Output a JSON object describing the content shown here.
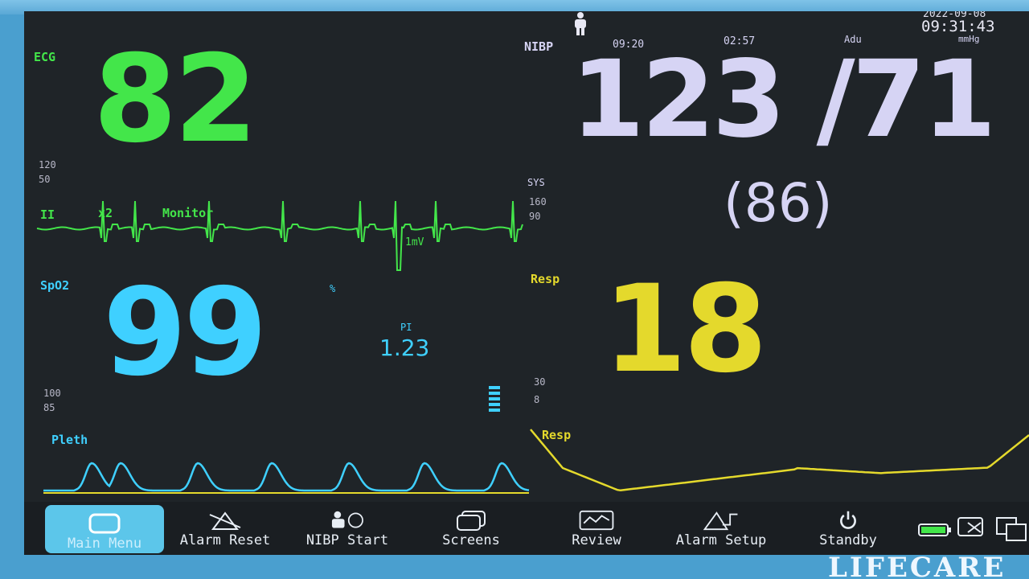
{
  "header": {
    "date": "2022-09-08",
    "time": "09:31:43",
    "patient_icon": "person-icon"
  },
  "ecg": {
    "label": "ECG",
    "hr": "82",
    "alarm_high": "120",
    "alarm_low": "50",
    "lead": "II",
    "gain": "x2",
    "mode": "Monitor",
    "scale": "1mV"
  },
  "nibp": {
    "label": "NIBP",
    "time": "09:20",
    "interval": "02:57",
    "patient_type": "Adu",
    "unit": "mmHg",
    "value": "123 /71",
    "mean": "(86)",
    "alarm_label": "SYS",
    "alarm_high": "160",
    "alarm_low": "90"
  },
  "spo2": {
    "label": "SpO2",
    "value": "99",
    "alarm_high": "100",
    "alarm_low": "85",
    "sat_indicator": "%",
    "pi_label": "PI",
    "pi_value": "1.23",
    "pleth_label": "Pleth"
  },
  "resp": {
    "label": "Resp",
    "value": "18",
    "alarm_high": "30",
    "alarm_low": "8",
    "wave_label": "Resp"
  },
  "menu": [
    {
      "label": "Main Menu",
      "icon": "monitor-icon"
    },
    {
      "label": "Alarm Reset",
      "icon": "alarm-reset-icon"
    },
    {
      "label": "NIBP Start",
      "icon": "nibp-start-icon"
    },
    {
      "label": "Screens",
      "icon": "screens-icon"
    },
    {
      "label": "Review",
      "icon": "review-icon"
    },
    {
      "label": "Alarm Setup",
      "icon": "alarm-setup-icon"
    },
    {
      "label": "Standby",
      "icon": "power-icon"
    }
  ],
  "status_icons": [
    "battery-icon",
    "network-icon",
    "display-icon"
  ],
  "brand": "LIFECARE",
  "colors": {
    "ecg": "#43e64a",
    "spo2": "#3fd0ff",
    "nibp": "#d6d4f4",
    "resp": "#e4d92c",
    "active_button": "#5cc6ea"
  }
}
